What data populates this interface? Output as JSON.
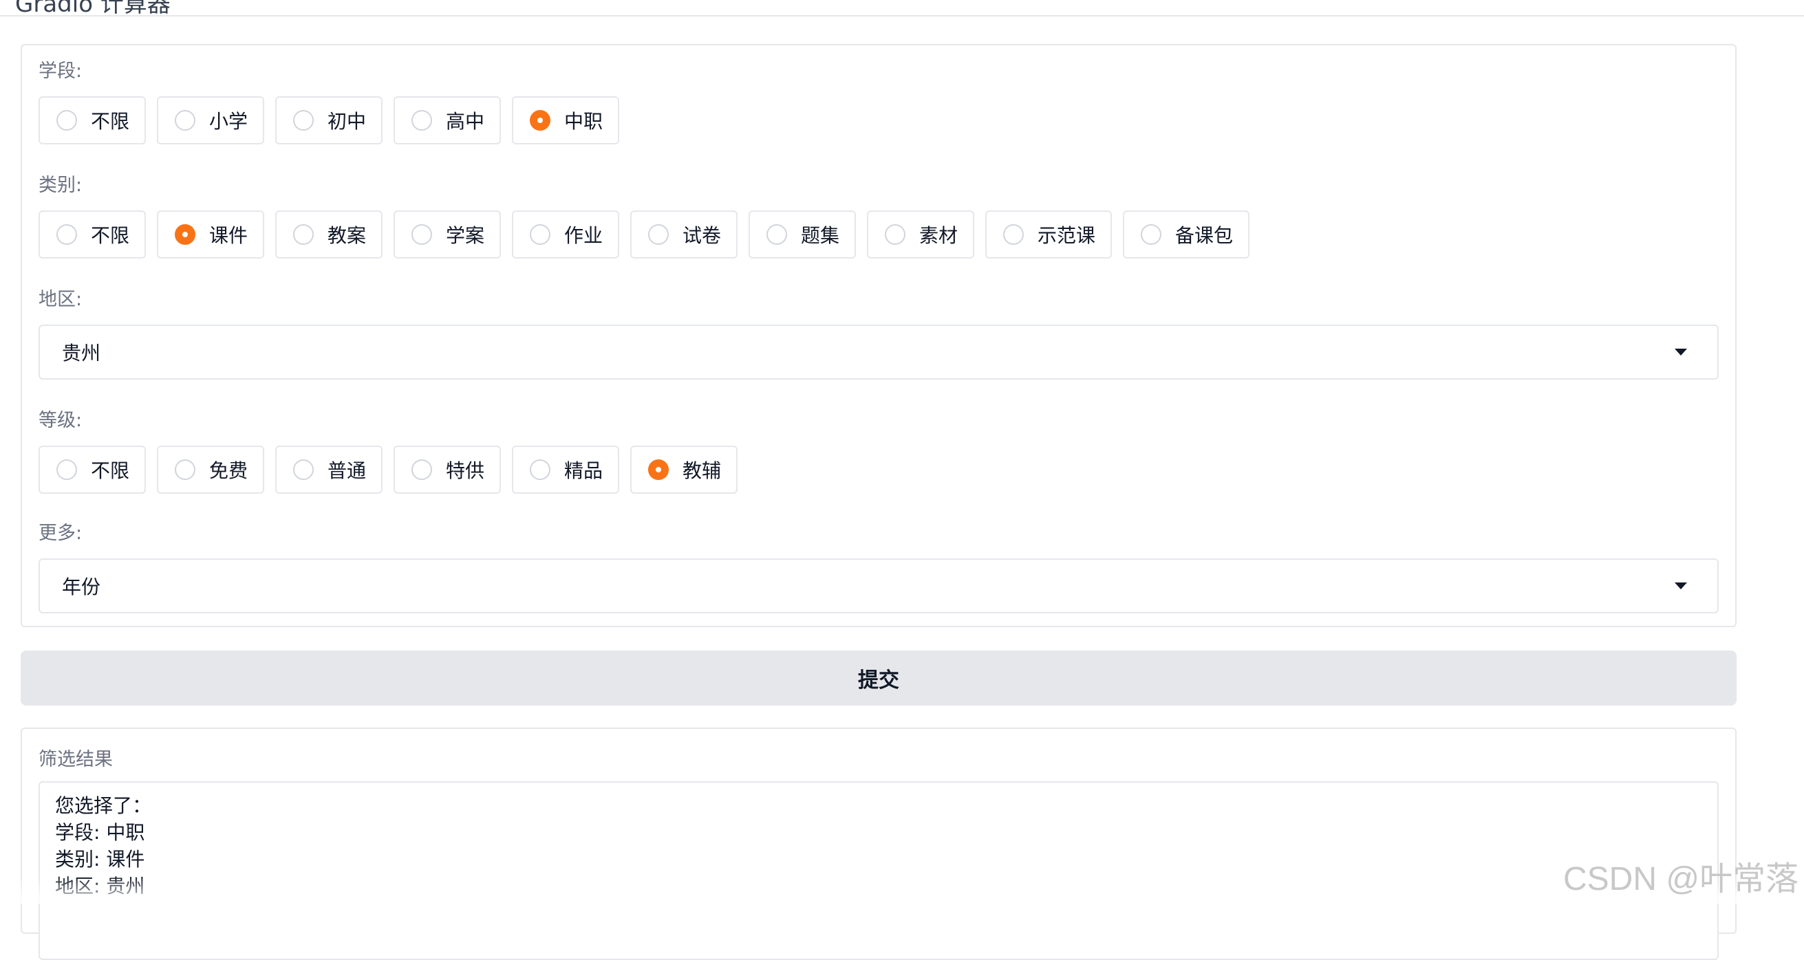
{
  "header": {
    "title": "Gradio 计算器"
  },
  "form": {
    "stage": {
      "label": "学段:",
      "options": [
        "不限",
        "小学",
        "初中",
        "高中",
        "中职"
      ],
      "selected": "中职"
    },
    "category": {
      "label": "类别:",
      "options": [
        "不限",
        "课件",
        "教案",
        "学案",
        "作业",
        "试卷",
        "题集",
        "素材",
        "示范课",
        "备课包"
      ],
      "selected": "课件"
    },
    "region": {
      "label": "地区:",
      "value": "贵州"
    },
    "level": {
      "label": "等级:",
      "options": [
        "不限",
        "免费",
        "普通",
        "特供",
        "精品",
        "教辅"
      ],
      "selected": "教辅"
    },
    "more": {
      "label": "更多:",
      "value": "年份"
    }
  },
  "submit_label": "提交",
  "result": {
    "label": "筛选结果",
    "lines": [
      "您选择了：",
      "学段: 中职",
      "类别: 课件",
      "地区: 贵州"
    ]
  },
  "watermark": "CSDN @叶常落",
  "colors": {
    "accent": "#f97316",
    "border": "#e5e7eb",
    "button_bg": "#e5e7eb",
    "label": "#6b7280"
  }
}
